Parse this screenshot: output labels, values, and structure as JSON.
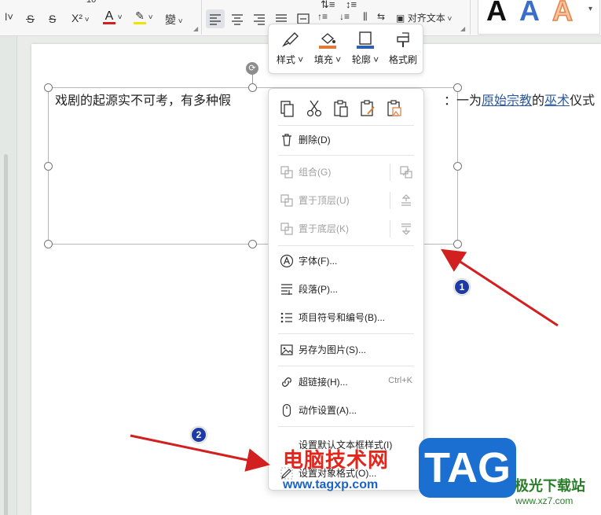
{
  "ribbon": {
    "font_size_value": "10",
    "strike_glyph": "S",
    "superscript_glyph": "X²",
    "font_color_glyph": "A",
    "highlight_glyph": "ab",
    "phonetic_glyph": "變",
    "align_text_label": "对齐文本",
    "art_letters": [
      "A",
      "A",
      "A"
    ]
  },
  "document": {
    "text_line_main": "戏剧的起源实不可考，有多种假",
    "text_line_suffix": "：一为",
    "link_1": "原始宗教",
    "text_between": "的",
    "link_2": "巫术",
    "text_tail": "仪式"
  },
  "mini_toolbar": {
    "items": [
      {
        "label": "样式",
        "icon": "brush-icon"
      },
      {
        "label": "填充",
        "icon": "fill-bucket-icon"
      },
      {
        "label": "轮廓",
        "icon": "outline-icon"
      },
      {
        "label": "格式刷",
        "icon": "format-painter-icon"
      }
    ]
  },
  "context_menu": {
    "top_icons": [
      "copy-icon",
      "cut-icon",
      "paste-icon",
      "paste-format-icon",
      "paste-image-icon"
    ],
    "delete": "删除(D)",
    "group": "组合(G)",
    "bring_to_front": "置于顶层(U)",
    "send_to_back": "置于底层(K)",
    "font": "字体(F)...",
    "paragraph": "段落(P)...",
    "bullets": "项目符号和编号(B)...",
    "save_as_picture": "另存为图片(S)...",
    "hyperlink": "超链接(H)...",
    "hyperlink_shortcut": "Ctrl+K",
    "action_settings": "动作设置(A)...",
    "set_default_textbox": "设置默认文本框样式(I)",
    "format_object": "设置对象格式(O)..."
  },
  "annotations": {
    "badge_1": "1",
    "badge_2": "2"
  },
  "watermark": {
    "site_cn": "电脑技术网",
    "site_url": "www.tagxp.com",
    "tag": "TAG",
    "jiguang": "极光下载站",
    "xz7": "www.xz7.com"
  },
  "colors": {
    "accent_blue": "#1e3aa6",
    "arrow_red": "#d21f1f",
    "link_blue": "#2c5aa0"
  }
}
